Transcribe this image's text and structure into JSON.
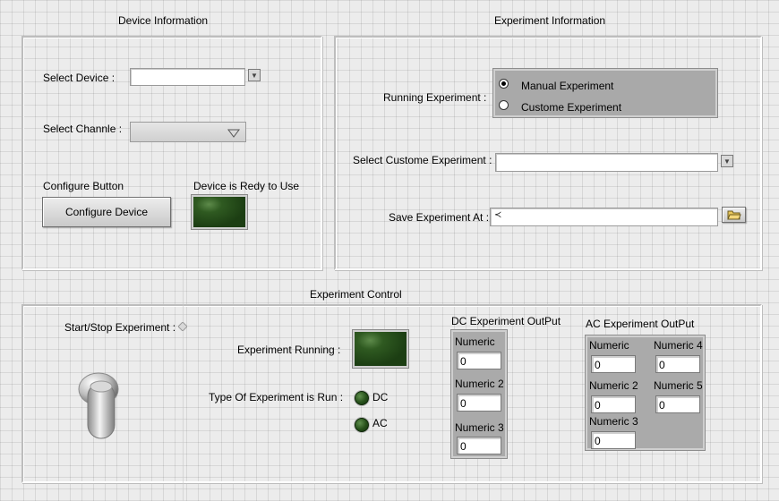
{
  "device_info": {
    "title": "Device Information",
    "select_device_label": "Select Device :",
    "select_device_value": "",
    "select_channel_label": "Select  Channle :",
    "select_channel_value": "",
    "configure_button_caption": "Configure Button",
    "configure_button_label": "Configure Device",
    "ready_led_label": "Device is Redy to Use"
  },
  "experiment_info": {
    "title": "Experiment Information",
    "running_experiment_label": "Running Experiment :",
    "options": [
      "Manual Experiment",
      "Custome Experiment"
    ],
    "selected_option": "Manual Experiment",
    "select_custom_label": "Select Custome Experiment :",
    "select_custom_value": "",
    "save_at_label": "Save Experiment At :",
    "save_at_value": ""
  },
  "experiment_control": {
    "title": "Experiment Control",
    "start_stop_label": "Start/Stop Experiment :",
    "running_label": "Experiment Running :",
    "type_label": "Type Of Experiment is Run :",
    "type_dc_label": "DC",
    "type_ac_label": "AC"
  },
  "dc_output": {
    "title": "DC Experiment OutPut",
    "fields": [
      {
        "label": "Numeric",
        "value": "0"
      },
      {
        "label": "Numeric 2",
        "value": "0"
      },
      {
        "label": "Numeric 3",
        "value": "0"
      }
    ]
  },
  "ac_output": {
    "title": "AC Experiment OutPut",
    "fields": [
      {
        "label": "Numeric",
        "value": "0"
      },
      {
        "label": "Numeric 4",
        "value": "0"
      },
      {
        "label": "Numeric 2",
        "value": "0"
      },
      {
        "label": "Numeric 5",
        "value": "0"
      },
      {
        "label": "Numeric 3",
        "value": "0"
      }
    ]
  },
  "colors": {
    "led_green": "#264f1a",
    "background": "#ececec"
  }
}
